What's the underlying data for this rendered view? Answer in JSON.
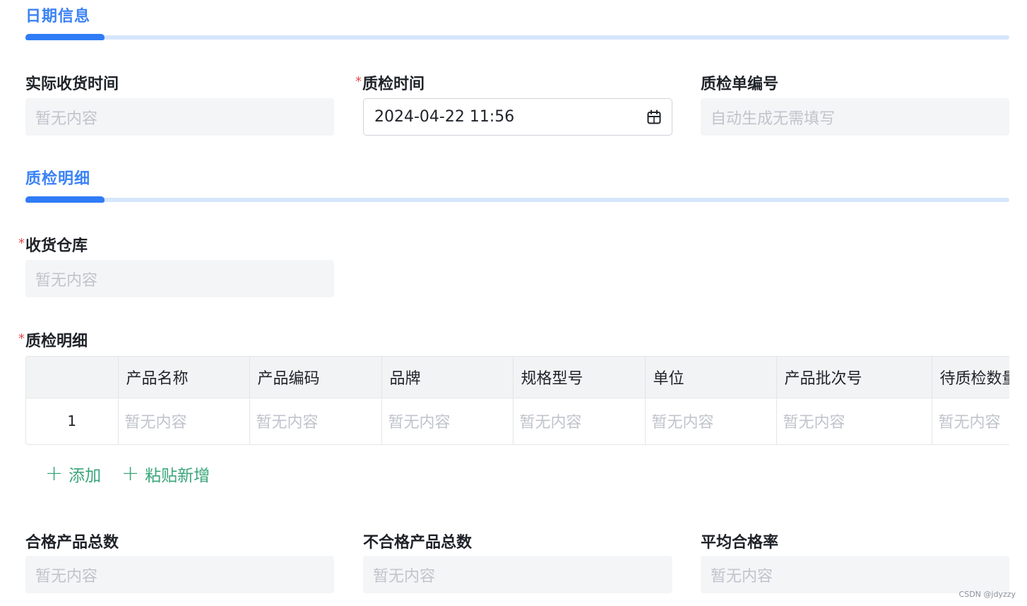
{
  "date_section": {
    "title": "日期信息",
    "actual_receipt": {
      "label": "实际收货时间",
      "value": "暂无内容"
    },
    "qc_time": {
      "required_mark": "*",
      "label": "质检时间",
      "value": "2024-04-22 11:56",
      "icon": "calendar-icon"
    },
    "qc_number": {
      "label": "质检单编号",
      "value": "自动生成无需填写"
    }
  },
  "detail_section": {
    "title": "质检明细",
    "warehouse": {
      "required_mark": "*",
      "label": "收货仓库",
      "value": "暂无内容"
    },
    "detail_table": {
      "required_mark": "*",
      "label": "质检明细",
      "columns": [
        "",
        "产品名称",
        "产品编码",
        "品牌",
        "规格型号",
        "单位",
        "产品批次号",
        "待质检数量"
      ],
      "rows": [
        {
          "index": "1",
          "cells": [
            "暂无内容",
            "暂无内容",
            "暂无内容",
            "暂无内容",
            "暂无内容",
            "暂无内容",
            "暂无内容"
          ]
        }
      ]
    },
    "actions": {
      "add": "添加",
      "paste_add": "粘贴新增",
      "icon": "plus-icon"
    }
  },
  "summary": {
    "qualified_total": {
      "label": "合格产品总数",
      "value": "暂无内容"
    },
    "unqualified_total": {
      "label": "不合格产品总数",
      "value": "暂无内容"
    },
    "pass_rate": {
      "label": "平均合格率",
      "value": "暂无内容"
    }
  },
  "watermark": "CSDN @jdyzzy",
  "colors": {
    "accent_blue": "#2f7cf6",
    "action_green": "#3aa57a",
    "required_red": "#e5484d"
  }
}
